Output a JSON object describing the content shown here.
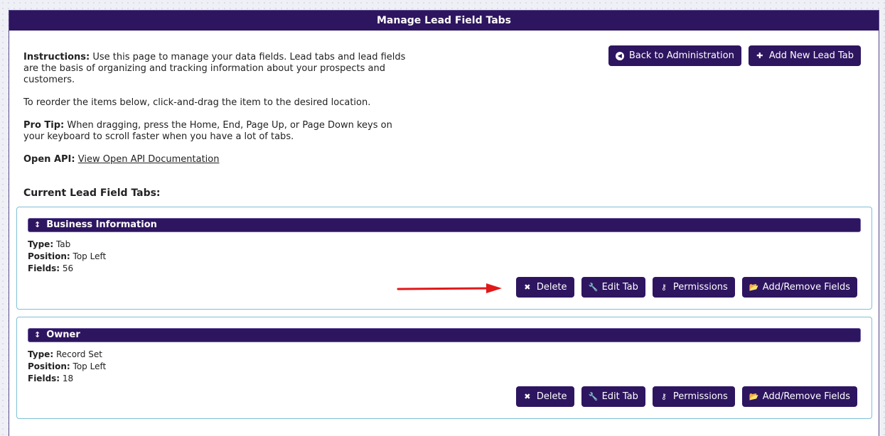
{
  "header": {
    "title": "Manage Lead Field Tabs"
  },
  "intro": {
    "instructions_label": "Instructions:",
    "instructions_text": " Use this page to manage your data fields. Lead tabs and lead fields are the basis of organizing and tracking information about your prospects and customers.",
    "reorder_text": "To reorder the items below, click-and-drag the item to the desired location.",
    "protip_label": "Pro Tip:",
    "protip_text": " When dragging, press the Home, End, Page Up, or Page Down keys on your keyboard to scroll faster when you have a lot of tabs.",
    "api_label": "Open API:",
    "api_link": "View Open API Documentation"
  },
  "top_buttons": {
    "back_label": "Back to Administration",
    "add_label": "Add New Lead Tab"
  },
  "section_title": "Current Lead Field Tabs:",
  "labels": {
    "type": "Type:",
    "position": "Position:",
    "fields": "Fields:"
  },
  "tabs": [
    {
      "name": "Business Information",
      "type": " Tab",
      "position": " Top Left",
      "fields": " 56"
    },
    {
      "name": "Owner",
      "type": " Record Set",
      "position": " Top Left",
      "fields": " 18"
    }
  ],
  "card_buttons": {
    "delete": "Delete",
    "edit": "Edit Tab",
    "permissions": "Permissions",
    "fields": "Add/Remove Fields"
  },
  "colors": {
    "brand": "#2e1560",
    "card_border": "#7fc0d8",
    "arrow": "#e0191a"
  },
  "icons": [
    "circle-left-icon",
    "plus-icon",
    "drag-handle-icon",
    "x-icon",
    "wrench-icon",
    "key-icon",
    "folder-open-icon"
  ]
}
